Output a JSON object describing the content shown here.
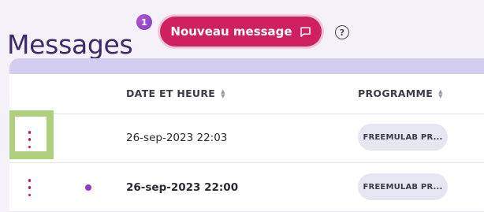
{
  "page": {
    "title": "Messages",
    "unread_count": "1"
  },
  "header": {
    "new_message_label": "Nouveau message",
    "help_symbol": "?"
  },
  "table": {
    "columns": [
      {
        "label": "DATE ET HEURE",
        "sortable": true
      },
      {
        "label": "PROGRAMME",
        "sortable": true
      }
    ],
    "rows": [
      {
        "datetime": "26-sep-2023 22:03",
        "program": "FREEMULAB PR...",
        "unread": false,
        "highlighted": true
      },
      {
        "datetime": "26-sep-2023 22:00",
        "program": "FREEMULAB PR...",
        "unread": true,
        "highlighted": false
      }
    ]
  },
  "icons": {
    "chat": "chat-bubble-icon",
    "help": "help-circle-icon",
    "sort": "sort-arrows-icon",
    "row_menu": "kebab-menu-icon",
    "unread": "unread-dot-icon"
  },
  "colors": {
    "title": "#3d2a6b",
    "primary_button": "#cf2060",
    "badge": "#8e3bbf",
    "card_band": "#d3cdf0",
    "program_pill": "#e5e6f2",
    "highlight": "#aed07c",
    "kebab": "#c2185b"
  }
}
